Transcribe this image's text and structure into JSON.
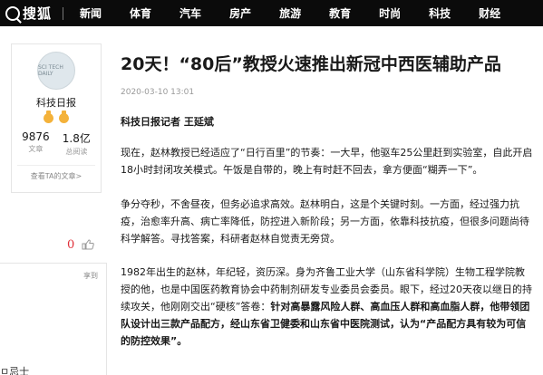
{
  "nav": {
    "logo": "搜狐",
    "items": [
      "新闻",
      "体育",
      "汽车",
      "房产",
      "旅游",
      "教育",
      "时尚",
      "科技",
      "财经"
    ]
  },
  "author": {
    "avatar_text": "SCI TECH DAILY",
    "name": "科技日报",
    "articles_value": "9876",
    "articles_label": "文章",
    "views_value": "1.8亿",
    "views_label": "总阅读",
    "view_all": "查看TA的文章>"
  },
  "sidebar": {
    "like_count": "0",
    "share_label": "享到",
    "bottom_text": "ㅁ忌士"
  },
  "article": {
    "title": "20天！“80后”教授火速推出新冠中西医辅助产品",
    "date": "2020-03-10 13:01",
    "byline": "科技日报记者 王延斌",
    "p1": "现在，赵林教授已经适应了“日行百里”的节奏：一大早，他驱车25公里赶到实验室，自此开启18小时封闭攻关模式。午饭是自带的，晚上有时赶不回去，拿方便面“糊弄一下”。",
    "p2": "争分夺秒，不舍昼夜，但务必追求高效。赵林明白，这是个关键时刻。一方面，经过强力抗疫，治愈率升高、病亡率降低，防控进入新阶段；另一方面，依靠科技抗疫，但很多问题尚待科学解答。寻找答案，科研者赵林自觉责无旁贷。",
    "p3_normal": "1982年出生的赵林，年纪轻，资历深。身为齐鲁工业大学（山东省科学院）生物工程学院教授的他，也是中国医药教育协会中药制剂研发专业委员会委员。眼下，经过20天夜以继日的持续攻关，他刚刚交出“硬核”答卷：",
    "p3_bold": "针对高暴露风险人群、高血压人群和高血脂人群，他带领团队设计出三款产品配方，经山东省卫健委和山东省中医院测试，认为“产品配方具有较为可信的防控效果”。"
  },
  "colors": {
    "nav_bg": "#0b0b0b",
    "accent_red": "#e0303a",
    "badge_gold": "#f4b23a"
  }
}
